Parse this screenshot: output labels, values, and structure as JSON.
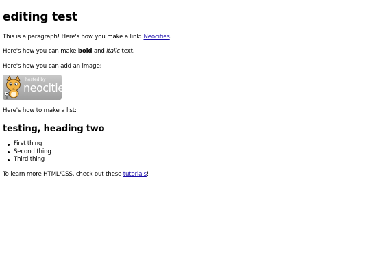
{
  "heading": "editing test",
  "para_link": {
    "before": "This is a paragraph! Here's how you make a link: ",
    "link": "Neocities",
    "after": "."
  },
  "para_bold": {
    "before": "Here's how you can make ",
    "bold": "bold",
    "middle": " and ",
    "italic": "italic",
    "after": " text."
  },
  "para_image": "Here's how you can add an image:",
  "badge": {
    "small_text": "hosted by",
    "big_text": "neocities",
    "icon": "neocities-cat-icon"
  },
  "para_list": "Here's how to make a list:",
  "subheading": "testing, heading two",
  "list_items": [
    "First thing",
    "Second thing",
    "Third thing"
  ],
  "para_learn": {
    "before": "To learn more HTML/CSS, check out these ",
    "link": "tutorials",
    "after": "!"
  },
  "colors": {
    "link": "#1a0dab",
    "badge": "#b5b5b5",
    "background": "#ffffff"
  }
}
